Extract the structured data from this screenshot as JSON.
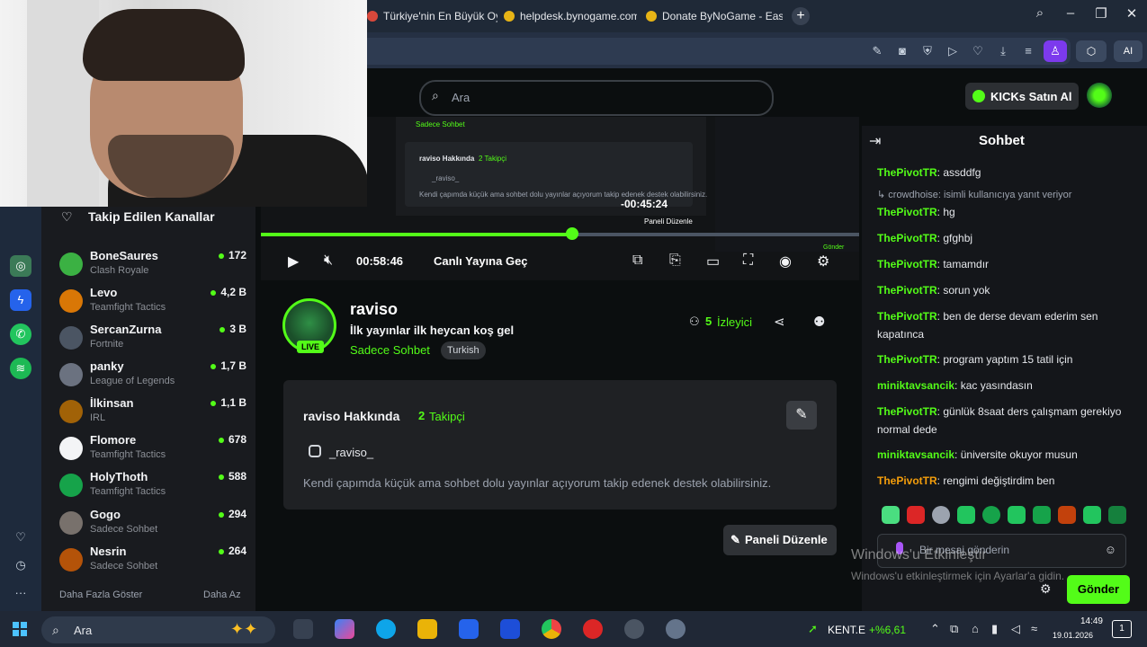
{
  "browser": {
    "tabs": [
      {
        "label": "Türkiye'nin En Büyük Oyu"
      },
      {
        "label": "helpdesk.bynogame.com"
      },
      {
        "label": "Donate ByNoGame - Eas"
      }
    ],
    "ai_label": "AI"
  },
  "header": {
    "search_placeholder": "Ara",
    "kicks_button": "KICKs Satın Al"
  },
  "sidebar": {
    "title": "Takip Edilen Kanallar",
    "channels": [
      {
        "name": "BoneSaures",
        "game": "Clash Royale",
        "viewers": "172",
        "color": "#3bb143"
      },
      {
        "name": "Levo",
        "game": "Teamfight Tactics",
        "viewers": "4,2 B",
        "color": "#d97706"
      },
      {
        "name": "SercanZurna",
        "game": "Fortnite",
        "viewers": "3 B",
        "color": "#4b5563"
      },
      {
        "name": "panky",
        "game": "League of Legends",
        "viewers": "1,7 B",
        "color": "#6b7280"
      },
      {
        "name": "İlkinsan",
        "game": "IRL",
        "viewers": "1,1 B",
        "color": "#a16207"
      },
      {
        "name": "Flomore",
        "game": "Teamfight Tactics",
        "viewers": "678",
        "color": "#f3f4f6"
      },
      {
        "name": "HolyThoth",
        "game": "Teamfight Tactics",
        "viewers": "588",
        "color": "#16a34a"
      },
      {
        "name": "Gogo",
        "game": "Sadece Sohbet",
        "viewers": "294",
        "color": "#78716c"
      },
      {
        "name": "Nesrin",
        "game": "Sadece Sohbet",
        "viewers": "264",
        "color": "#b45309"
      }
    ],
    "show_more": "Daha Fazla Göster",
    "show_less": "Daha Az"
  },
  "player": {
    "time": "00:58:46",
    "live_label": "Canlı Yayına Geç",
    "progress": 0.52,
    "embedded": {
      "category": "Sadece Sohbet",
      "about": "raviso Hakkında",
      "followers": "2 Takipçi",
      "handle": "_raviso_",
      "desc": "Kendi çapımda küçük ama sohbet dolu yayınlar açıyorum takip edenek destek olabilirsiniz.",
      "remaining": "-00:45:24",
      "panel_btn": "Paneli Düzenle",
      "send_btn": "Gönder"
    }
  },
  "stream": {
    "name": "raviso",
    "title": "İlk yayınlar ilk heycan koş gel",
    "category": "Sadece Sohbet",
    "tag": "Turkish",
    "live_badge": "LIVE",
    "viewer_count": "5",
    "viewer_label": "İzleyici"
  },
  "about": {
    "title": "raviso Hakkında",
    "follower_count": "2",
    "follower_label": "Takipçi",
    "instagram": "_raviso_",
    "description": "Kendi çapımda küçük ama sohbet dolu yayınlar açıyorum takip edenek destek olabilirsiniz.",
    "edit_panels": "Paneli Düzenle"
  },
  "chat": {
    "title": "Sohbet",
    "reply_note": "crowdhoise: isimli kullanıcıya yanıt veriyor",
    "messages": [
      {
        "user": "ThePivotTR",
        "text": "assddfg",
        "color": "green"
      },
      {
        "user": "ThePivotTR",
        "text": "hg",
        "color": "green"
      },
      {
        "user": "ThePivotTR",
        "text": "gfghbj",
        "color": "green"
      },
      {
        "user": "ThePivotTR",
        "text": "tamamdır",
        "color": "green"
      },
      {
        "user": "ThePivotTR",
        "text": "sorun yok",
        "color": "green"
      },
      {
        "user": "ThePivotTR",
        "text": "ben de derse devam ederim sen kapatınca",
        "color": "green"
      },
      {
        "user": "ThePivotTR",
        "text": "program yaptım 15 tatil için",
        "color": "green"
      },
      {
        "user": "miniktavsancik",
        "text": "kac yasındasın",
        "color": "green"
      },
      {
        "user": "ThePivotTR",
        "text": "günlük 8saat ders çalışmam gerekiyo normal dede",
        "color": "green"
      },
      {
        "user": "miniktavsancik",
        "text": "üniversite okuyor musun",
        "color": "green"
      },
      {
        "user": "ThePivotTR",
        "text": "rengimi değiştirdim ben",
        "color": "orange"
      }
    ],
    "input_placeholder": "Bir mesaj gönderin",
    "send_label": "Gönder"
  },
  "watermark": {
    "line1": "Windows'u Etkinleştir",
    "line2": "Windows'u etkinleştirmek için Ayarlar'a gidin."
  },
  "taskbar": {
    "search_placeholder": "Ara",
    "stock_name": "KENT.E",
    "stock_change": "+%6,61",
    "time": "14:49",
    "date": "19.01.2026",
    "notifications": "1"
  }
}
